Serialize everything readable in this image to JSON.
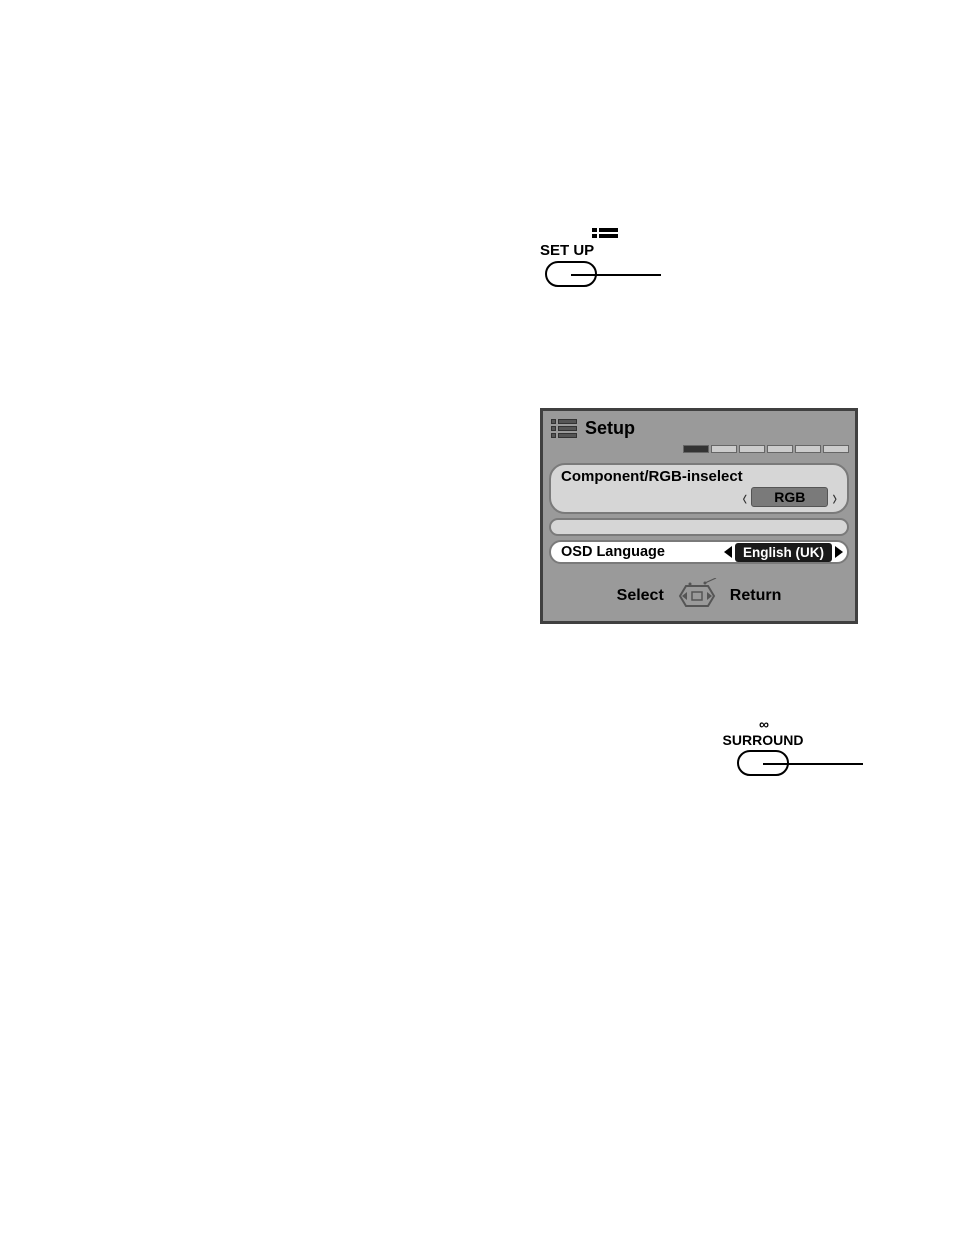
{
  "setup_button": {
    "label": "SET UP"
  },
  "osd": {
    "title": "Setup",
    "field1": {
      "label": "Component/RGB-inselect",
      "value": "RGB"
    },
    "field2": {
      "label": "OSD Language",
      "value": "English (UK)"
    },
    "footer": {
      "select": "Select",
      "return": "Return"
    }
  },
  "surround_button": {
    "label": "SURROUND"
  }
}
